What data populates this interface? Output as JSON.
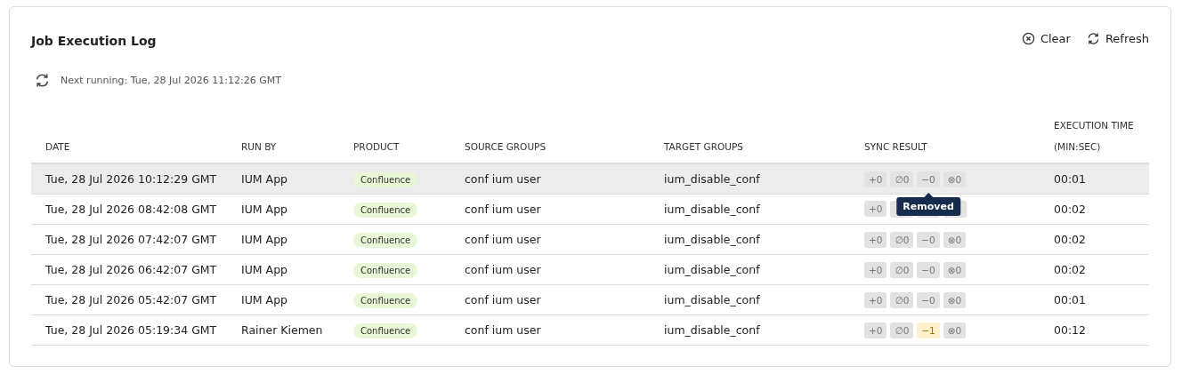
{
  "title": "Job Execution Log",
  "actions": [
    {
      "kind": "clear",
      "label": "Clear"
    },
    {
      "kind": "refresh",
      "label": "Refresh"
    }
  ],
  "next_running": "Next running: Tue, 28 Jul 2026 11:12:26 GMT",
  "table": {
    "columns": [
      "DATE",
      "RUN BY",
      "PRODUCT",
      "SOURCE GROUPS",
      "TARGET GROUPS",
      "SYNC RESULT",
      "EXECUTION TIME\n(MIN:SEC)"
    ],
    "rows": [
      {
        "hovered": true,
        "date": "Tue, 28 Jul 2026 10:12:29 GMT",
        "run_by": "IUM App",
        "product": "Confluence",
        "source": "conf ium user",
        "target": "ium_disable_conf",
        "sync": [
          {
            "text": "+0",
            "highlighted": false
          },
          {
            "text": "∅0",
            "highlighted": false
          },
          {
            "text": "−0",
            "highlighted": false,
            "tooltip": "Removed"
          },
          {
            "text": "⊗0",
            "highlighted": false
          }
        ],
        "time": "00:01"
      },
      {
        "hovered": false,
        "date": "Tue, 28 Jul 2026 08:42:08 GMT",
        "run_by": "IUM App",
        "product": "Confluence",
        "source": "conf ium user",
        "target": "ium_disable_conf",
        "sync": [
          {
            "text": "+0",
            "highlighted": false
          },
          {
            "highlighted": false
          },
          {
            "highlighted": false
          },
          {
            "highlighted": false
          }
        ],
        "time": "00:02"
      },
      {
        "hovered": false,
        "date": "Tue, 28 Jul 2026 07:42:07 GMT",
        "run_by": "IUM App",
        "product": "Confluence",
        "source": "conf ium user",
        "target": "ium_disable_conf",
        "sync": [
          {
            "text": "+0",
            "highlighted": false
          },
          {
            "text": "∅0",
            "highlighted": false
          },
          {
            "text": "−0",
            "highlighted": false
          },
          {
            "text": "⊗0",
            "highlighted": false
          }
        ],
        "time": "00:02"
      },
      {
        "hovered": false,
        "date": "Tue, 28 Jul 2026 06:42:07 GMT",
        "run_by": "IUM App",
        "product": "Confluence",
        "source": "conf ium user",
        "target": "ium_disable_conf",
        "sync": [
          {
            "text": "+0",
            "highlighted": false
          },
          {
            "text": "∅0",
            "highlighted": false
          },
          {
            "text": "−0",
            "highlighted": false
          },
          {
            "text": "⊗0",
            "highlighted": false
          }
        ],
        "time": "00:02"
      },
      {
        "hovered": false,
        "date": "Tue, 28 Jul 2026 05:42:07 GMT",
        "run_by": "IUM App",
        "product": "Confluence",
        "source": "conf ium user",
        "target": "ium_disable_conf",
        "sync": [
          {
            "text": "+0",
            "highlighted": false
          },
          {
            "text": "∅0",
            "highlighted": false
          },
          {
            "text": "−0",
            "highlighted": false
          },
          {
            "text": "⊗0",
            "highlighted": false
          }
        ],
        "time": "00:01"
      },
      {
        "hovered": false,
        "date": "Tue, 28 Jul 2026 05:19:34 GMT",
        "run_by": "Rainer Kiemen",
        "product": "Confluence",
        "source": "conf ium user",
        "target": "ium_disable_conf",
        "sync": [
          {
            "text": "+0",
            "highlighted": false
          },
          {
            "text": "∅0",
            "highlighted": false
          },
          {
            "text": "−1",
            "highlighted": true
          },
          {
            "text": "⊗0",
            "highlighted": false
          }
        ],
        "time": "00:12"
      }
    ]
  }
}
